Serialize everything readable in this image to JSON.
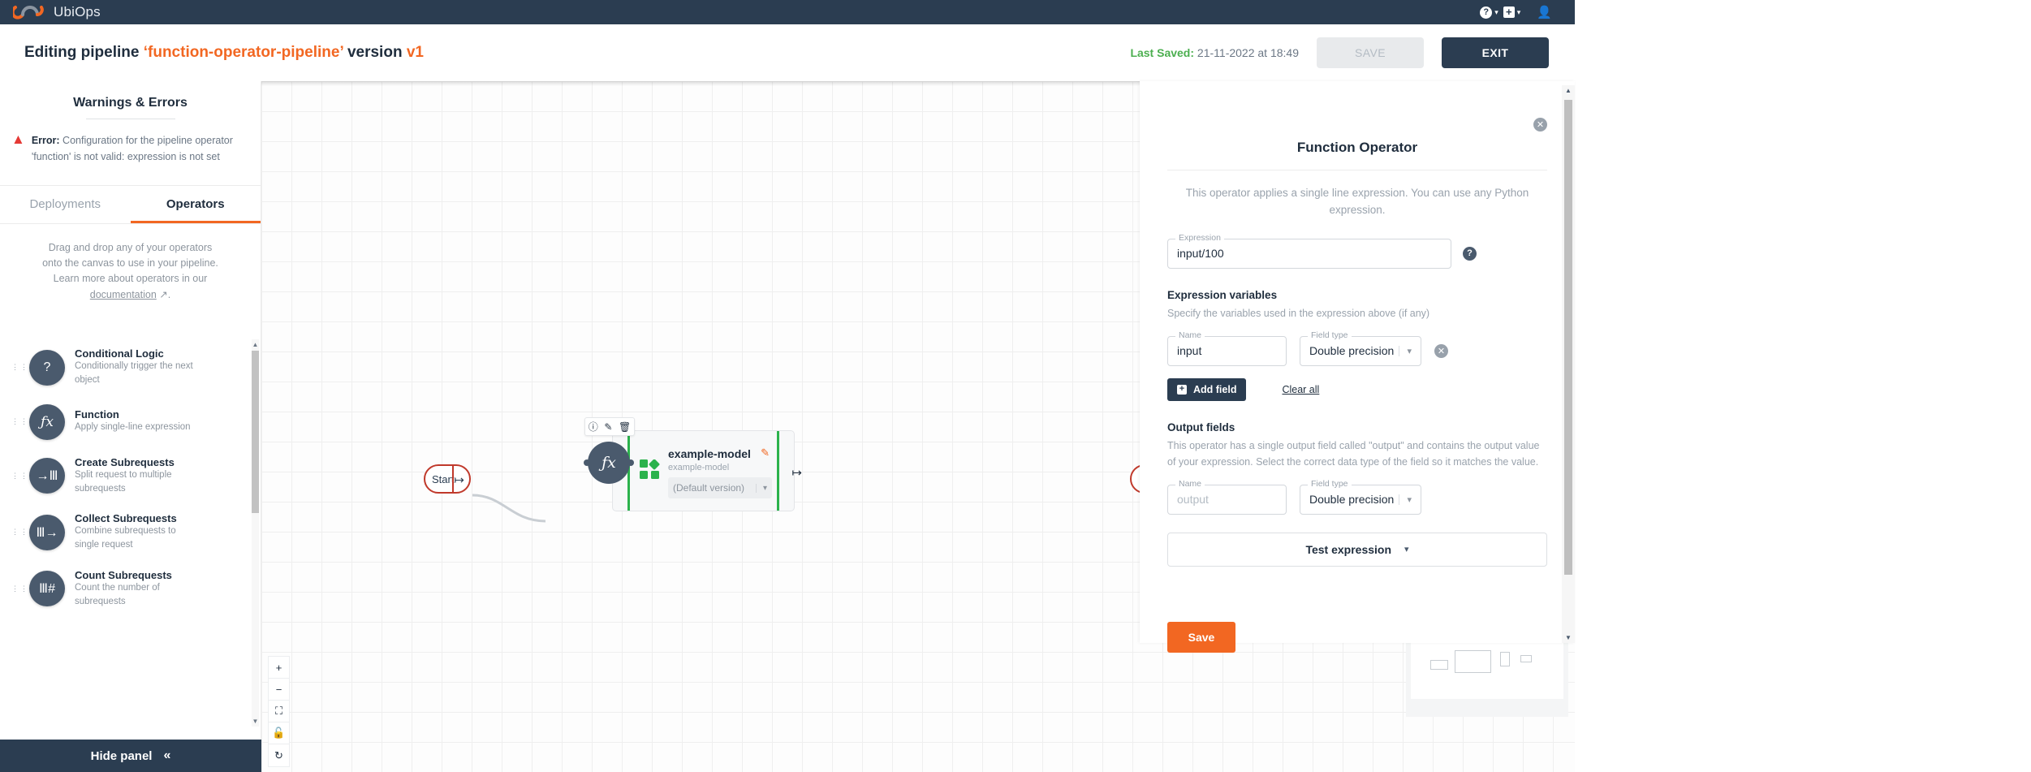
{
  "topnav": {
    "brand": "UbiOps",
    "help_icon": "question-mark-icon",
    "add_icon": "plus-icon",
    "account_icon": "person-icon",
    "chevron": "⌄"
  },
  "header": {
    "prefix": "Editing pipeline ",
    "pipeline_name": "‘function-operator-pipeline’",
    "version_label": " version ",
    "version": "v1",
    "last_saved_label": "Last Saved:",
    "last_saved_value": "21-11-2022 at 18:49",
    "save_label": "SAVE",
    "exit_label": "EXIT"
  },
  "left_panel": {
    "warnings_title": "Warnings & Errors",
    "error": {
      "label": "Error:",
      "message": "Configuration for the pipeline operator 'function' is not valid: expression is not set"
    },
    "tabs": [
      {
        "label": "Deployments",
        "active": false
      },
      {
        "label": "Operators",
        "active": true
      }
    ],
    "hint_line1": "Drag and drop any of your operators",
    "hint_line2": "onto the canvas to use in your pipeline.",
    "hint_line3": "Learn more about operators in our",
    "hint_link": "documentation",
    "hint_link_icon": "external-link-icon",
    "operators": [
      {
        "icon": "question-mark-icon",
        "glyph": "?",
        "title": "Conditional Logic",
        "desc": "Conditionally trigger the next object"
      },
      {
        "icon": "function-fx-icon",
        "glyph": "ƒx",
        "title": "Function",
        "desc": "Apply single-line expression"
      },
      {
        "icon": "create-subrequests-icon",
        "glyph": "→Ⅲ",
        "title": "Create Subrequests",
        "desc": "Split request to multiple subrequests"
      },
      {
        "icon": "collect-subrequests-icon",
        "glyph": "Ⅲ→",
        "title": "Collect Subrequests",
        "desc": "Combine subrequests to single request"
      },
      {
        "icon": "count-subrequests-icon",
        "glyph": "Ⅲ#",
        "title": "Count Subrequests",
        "desc": "Count the number of subrequests"
      }
    ],
    "hide_panel_label": "Hide panel",
    "hide_panel_icon": "double-chevron-left-icon"
  },
  "canvas": {
    "start_node_label": "Start",
    "start_out_port_icon": "output-port-icon",
    "deployment_node": {
      "name": "example-model",
      "subtitle": "example-model",
      "version_value": "(Default version)",
      "edit_icon": "pencil-icon",
      "in_port_icon": "input-port-icon",
      "out_port_icon": "output-port-icon",
      "type_icon": "deployment-blocks-icon"
    },
    "operator_node": {
      "glyph": "ƒx",
      "toolbar": [
        {
          "icon": "info-icon",
          "glyph": "ℹ"
        },
        {
          "icon": "pencil-icon",
          "glyph": "✎"
        },
        {
          "icon": "trash-icon",
          "glyph": "🗑"
        }
      ]
    },
    "controls": [
      {
        "icon": "zoom-in-icon",
        "glyph": "+"
      },
      {
        "icon": "zoom-out-icon",
        "glyph": "−"
      },
      {
        "icon": "fit-to-screen-icon",
        "glyph": "⛶"
      },
      {
        "icon": "lock-icon",
        "glyph": "🔓"
      },
      {
        "icon": "reset-icon",
        "glyph": "↻"
      }
    ],
    "minimap_icon": "minimap"
  },
  "right_panel": {
    "close_icon": "close-icon",
    "title": "Function Operator",
    "description": "This operator applies a single line expression. You can use any Python expression.",
    "expression_field": {
      "legend": "Expression",
      "value": "input/100"
    },
    "help_icon": "question-mark-icon",
    "expression_variables": {
      "heading": "Expression variables",
      "description": "Specify the variables used in the expression above (if any)",
      "name_legend": "Name",
      "name_value": "input",
      "type_legend": "Field type",
      "type_value": "Double precision",
      "remove_icon": "remove-field-icon",
      "add_field_label": "Add field",
      "add_field_icon": "plus-icon",
      "clear_all_label": "Clear all"
    },
    "output_fields": {
      "heading": "Output fields",
      "description": "This operator has a single output field called \"output\" and contains the output value of your expression. Select the correct data type of the field so it matches the value.",
      "name_legend": "Name",
      "name_placeholder": "output",
      "type_legend": "Field type",
      "type_value": "Double precision"
    },
    "test_expression_label": "Test expression",
    "test_expression_icon": "chevron-down-icon",
    "save_label": "Save"
  },
  "colors": {
    "brand_orange": "#f26722",
    "navy": "#2b3d51",
    "error_red": "#e53935",
    "success_green": "#4caf50",
    "node_green": "#2bb24c"
  }
}
